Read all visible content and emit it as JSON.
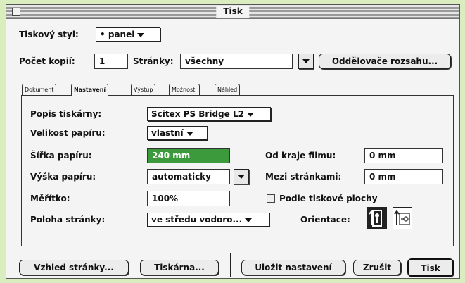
{
  "window": {
    "title": "Tisk"
  },
  "style_row": {
    "label": "Tiskový styl:",
    "value": "• panel"
  },
  "copies_row": {
    "copies_label": "Počet kopií:",
    "copies_value": "1",
    "pages_label": "Stránky:",
    "pages_value": "všechny",
    "separators_button": "Oddělovače rozsahu..."
  },
  "tabs": [
    {
      "label": "Dokument",
      "active": false
    },
    {
      "label": "Nastavení",
      "active": true
    },
    {
      "label": "Výstup",
      "active": false
    },
    {
      "label": "Možnosti",
      "active": false
    },
    {
      "label": "Náhled",
      "active": false
    }
  ],
  "settings": {
    "printer_desc_label": "Popis tiskárny:",
    "printer_desc_value": "Scitex PS Bridge L2",
    "paper_size_label": "Velikost papíru:",
    "paper_size_value": "vlastní",
    "paper_width_label": "Šířka papíru:",
    "paper_width_value": "240  mm",
    "paper_height_label": "Výška papíru:",
    "paper_height_value": "automaticky",
    "scale_label": "Měřítko:",
    "scale_value": "100%",
    "position_label": "Poloha stránky:",
    "position_value": "ve středu vodoro...",
    "film_edge_label": "Od kraje filmu:",
    "film_edge_value": "0  mm",
    "between_pages_label": "Mezi stránkami:",
    "between_pages_value": "0  mm",
    "fit_label": "Podle tiskové plochy",
    "fit_checked": false,
    "orientation_label": "Orientace:",
    "highlight_color": "#3c9a3c"
  },
  "buttons": {
    "page_setup": "Vzhled stránky...",
    "printer": "Tiskárna...",
    "save_settings": "Uložit nastavení",
    "cancel": "Zrušit",
    "print": "Tisk"
  }
}
